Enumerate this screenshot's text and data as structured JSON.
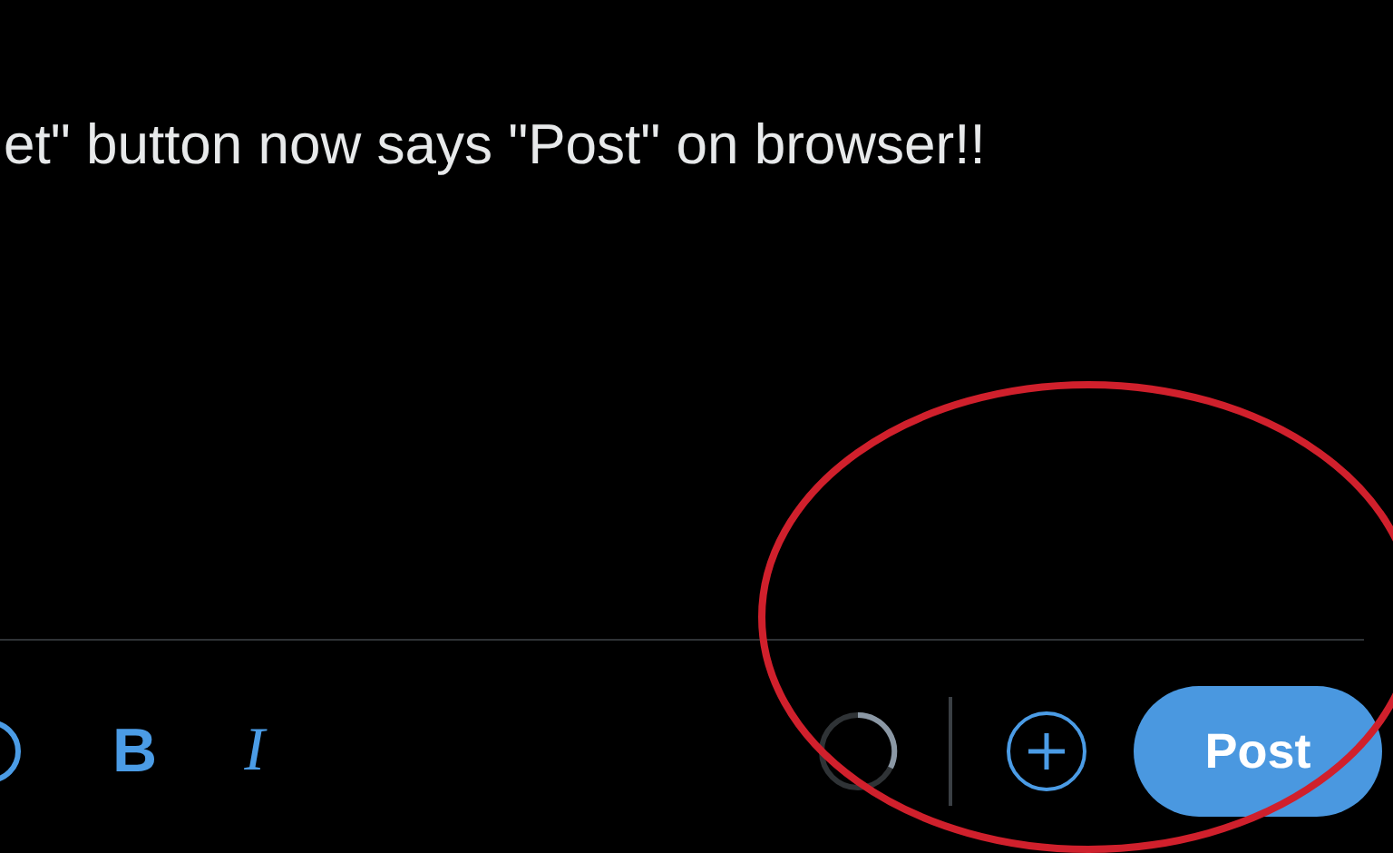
{
  "tweet_text": "et\" button now says \"Post\" on browser!!",
  "toolbar": [
    {
      "kind": "circle"
    },
    {
      "kind": "bold",
      "label": "B"
    },
    {
      "kind": "italic",
      "label": "I"
    }
  ],
  "post_button": {
    "label": "Post"
  }
}
